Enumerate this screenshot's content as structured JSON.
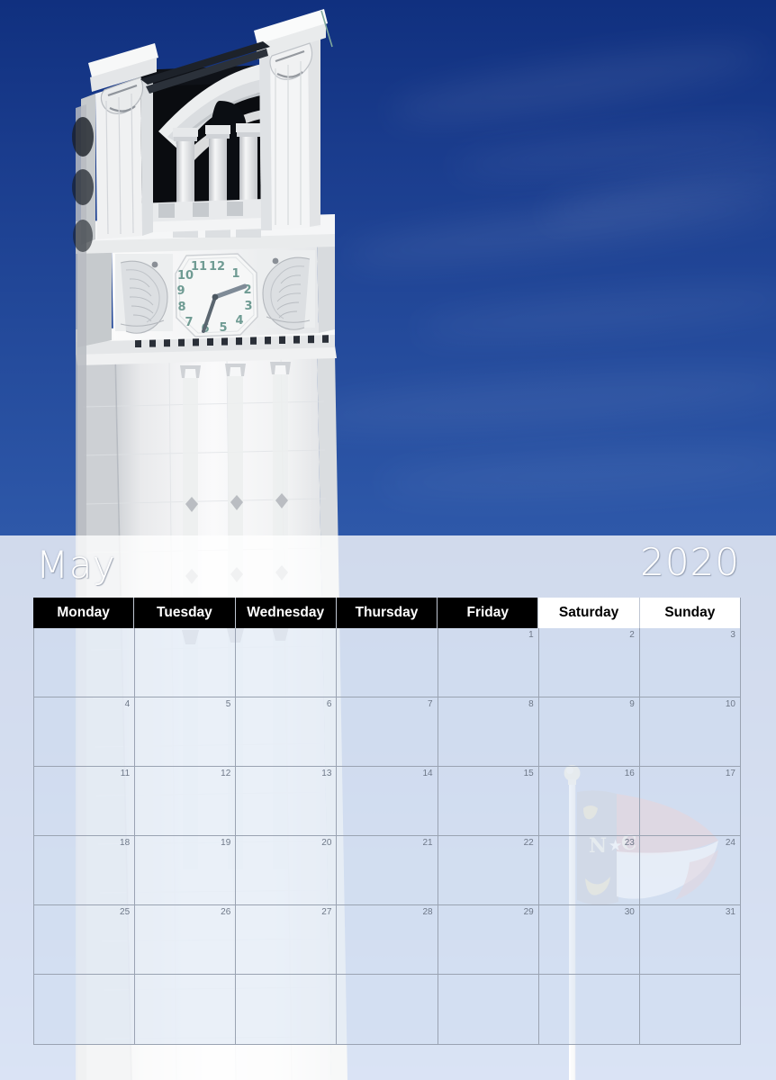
{
  "calendar": {
    "month": "May",
    "year": "2020",
    "day_headers": [
      {
        "label": "Monday",
        "type": "weekday"
      },
      {
        "label": "Tuesday",
        "type": "weekday"
      },
      {
        "label": "Wednesday",
        "type": "weekday"
      },
      {
        "label": "Thursday",
        "type": "weekday"
      },
      {
        "label": "Friday",
        "type": "weekday"
      },
      {
        "label": "Saturday",
        "type": "weekend"
      },
      {
        "label": "Sunday",
        "type": "weekend"
      }
    ],
    "weeks": [
      [
        "",
        "",
        "",
        "",
        "1",
        "2",
        "3"
      ],
      [
        "4",
        "5",
        "6",
        "7",
        "8",
        "9",
        "10"
      ],
      [
        "11",
        "12",
        "13",
        "14",
        "15",
        "16",
        "17"
      ],
      [
        "18",
        "19",
        "20",
        "21",
        "22",
        "23",
        "24"
      ],
      [
        "25",
        "26",
        "27",
        "28",
        "29",
        "30",
        "31"
      ],
      [
        "",
        "",
        "",
        "",
        "",
        "",
        ""
      ]
    ]
  },
  "photo": {
    "subject": "memorial-belltower",
    "clock_numerals": [
      "12",
      "1",
      "2",
      "3",
      "4",
      "5",
      "6",
      "7",
      "8",
      "9",
      "10",
      "11"
    ],
    "flag": "north-carolina-state-flag",
    "flag_letters": {
      "left": "N",
      "right": "C"
    }
  },
  "colors": {
    "sky_top": "#10307f",
    "sky_bottom": "#5782d0",
    "stone": "#f2f3f4",
    "header_weekday_bg": "#000000",
    "header_weekend_bg": "#ffffff",
    "grid_line": "#9aa3b2",
    "daynum": "#6e7888",
    "flag_blue": "#3c4a6b",
    "flag_red": "#b4373f",
    "flag_white": "#ffffff",
    "flag_gold": "#d6b24a",
    "clock_numeral": "#6f9b93"
  }
}
